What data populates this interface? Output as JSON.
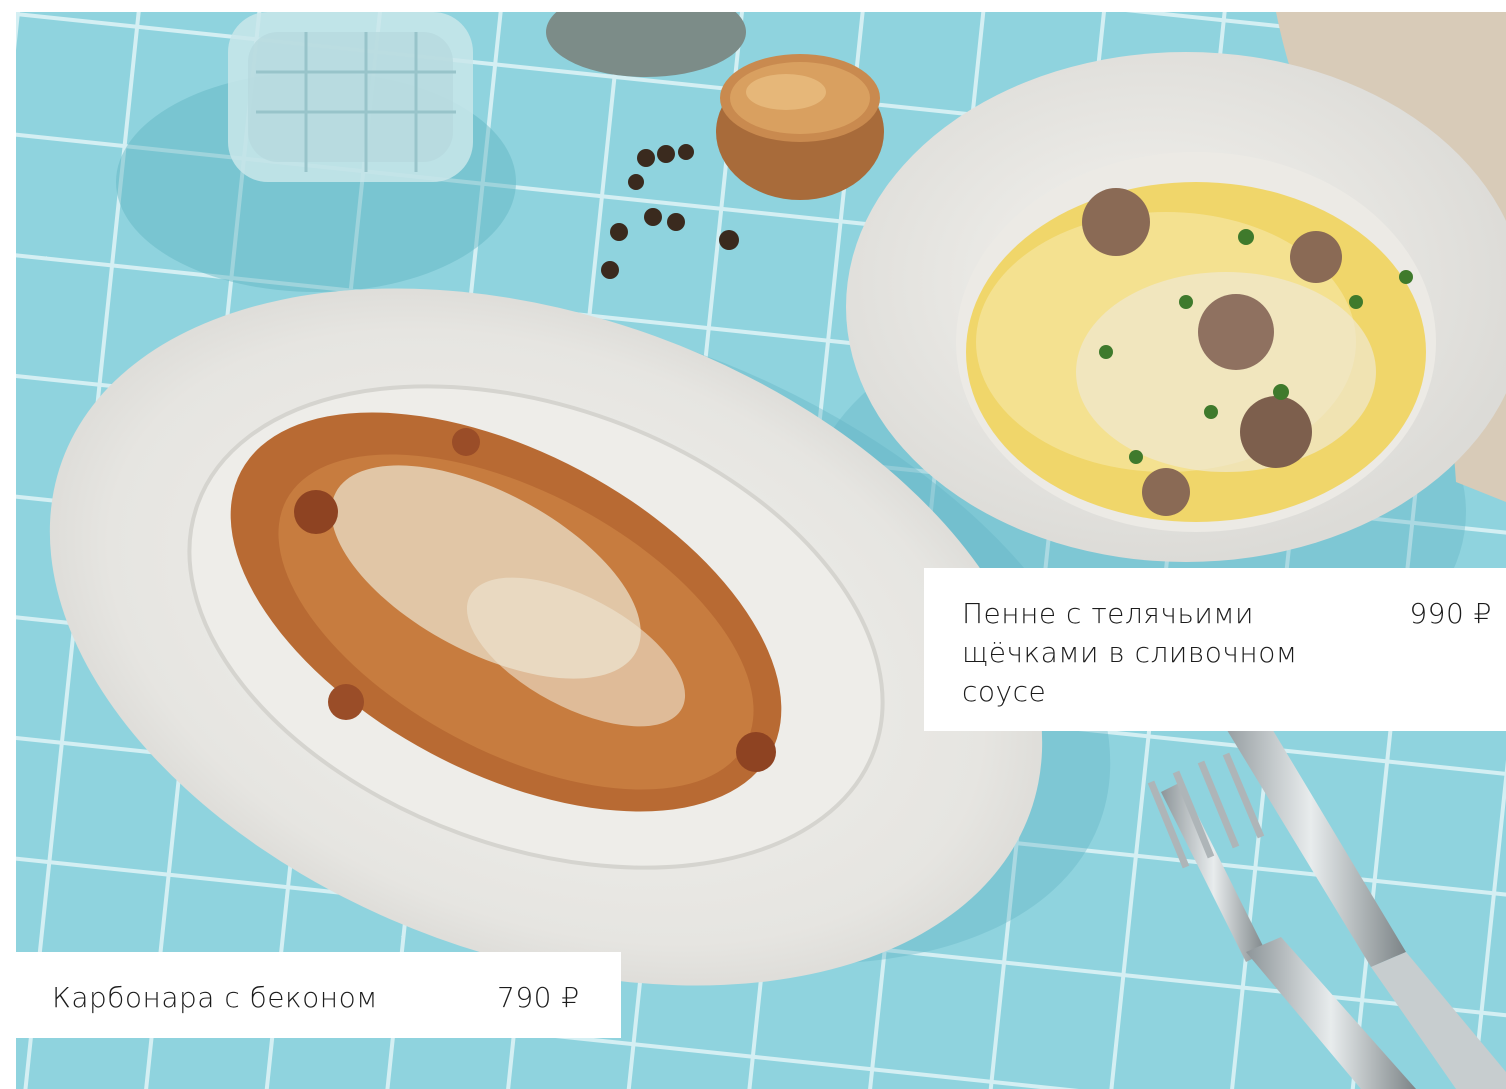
{
  "dishes": [
    {
      "name": "Пенне с телячьими щёчками в сливочном соусе",
      "name_lines": [
        "Пенне с телячьими",
        "щёчками в сливочном",
        "соусе"
      ],
      "price": "990 ₽"
    },
    {
      "name": "Карбонара с беконом",
      "price": "790 ₽"
    }
  ],
  "colors": {
    "tiles": "#8fd3de",
    "grout": "#d9f1f4",
    "plate": "#ecebe7",
    "card": "#ffffff",
    "text": "#1c1c1c"
  }
}
